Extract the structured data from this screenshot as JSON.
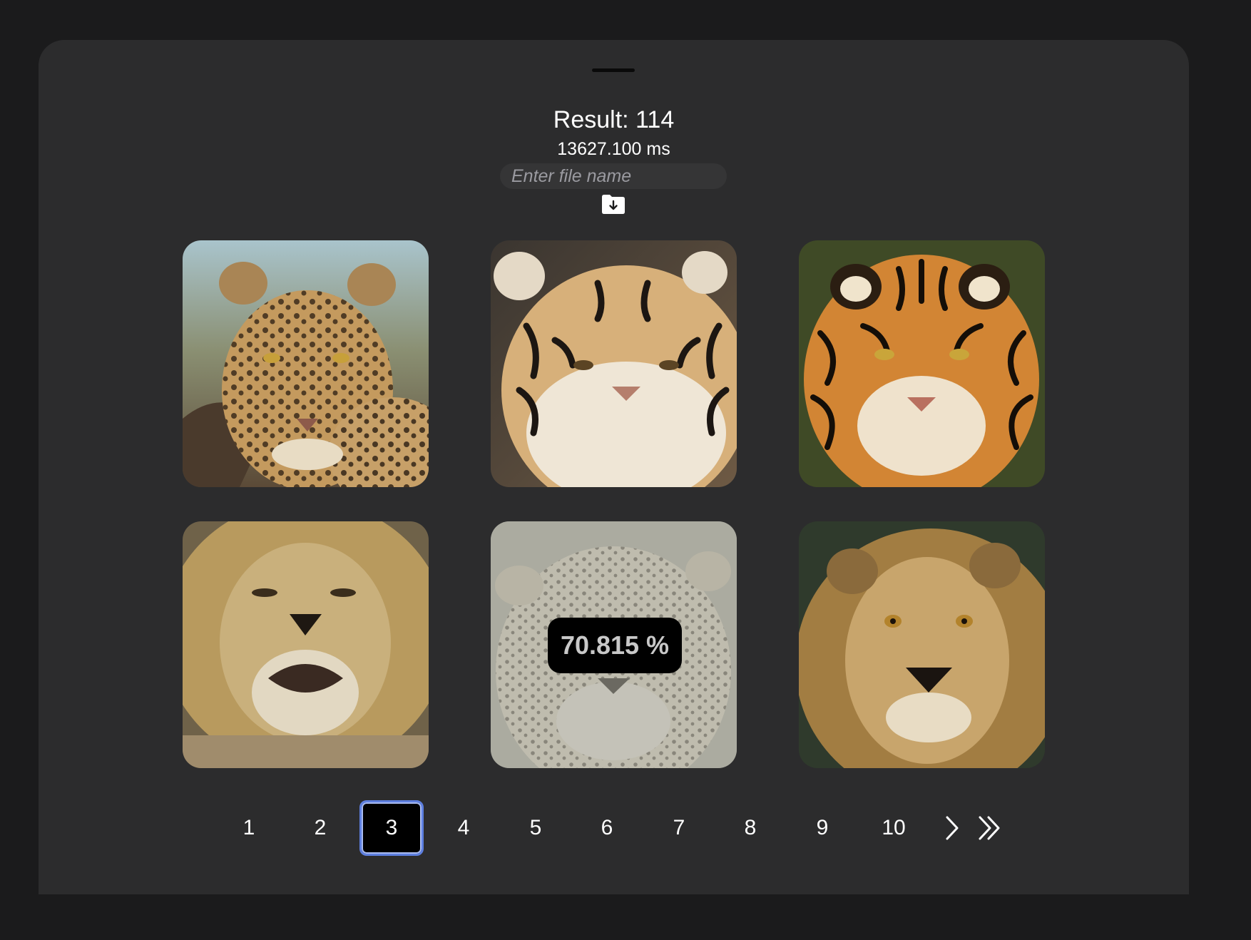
{
  "panel": {
    "result_label": "Result: 114",
    "elapsed": "13627.100 ms",
    "file_name": {
      "value": "",
      "placeholder": "Enter file name"
    },
    "save_icon": "folder-download-icon"
  },
  "gallery": {
    "tiles": [
      {
        "subject": "leopard-photo"
      },
      {
        "subject": "tiger-photo"
      },
      {
        "subject": "tiger-photo"
      },
      {
        "subject": "lion-photo"
      },
      {
        "subject": "cheetah-photo",
        "selected": true,
        "score": "70.815 %"
      },
      {
        "subject": "lion-photo"
      }
    ]
  },
  "pagination": {
    "pages": [
      "1",
      "2",
      "3",
      "4",
      "5",
      "6",
      "7",
      "8",
      "9",
      "10"
    ],
    "current": "3",
    "next_icon": "chevron-right-icon",
    "last_icon": "double-chevron-right-icon"
  },
  "colors": {
    "background": "#1b1b1c",
    "panel": "#2c2c2d",
    "active_page_border": "#5d7fe0"
  }
}
